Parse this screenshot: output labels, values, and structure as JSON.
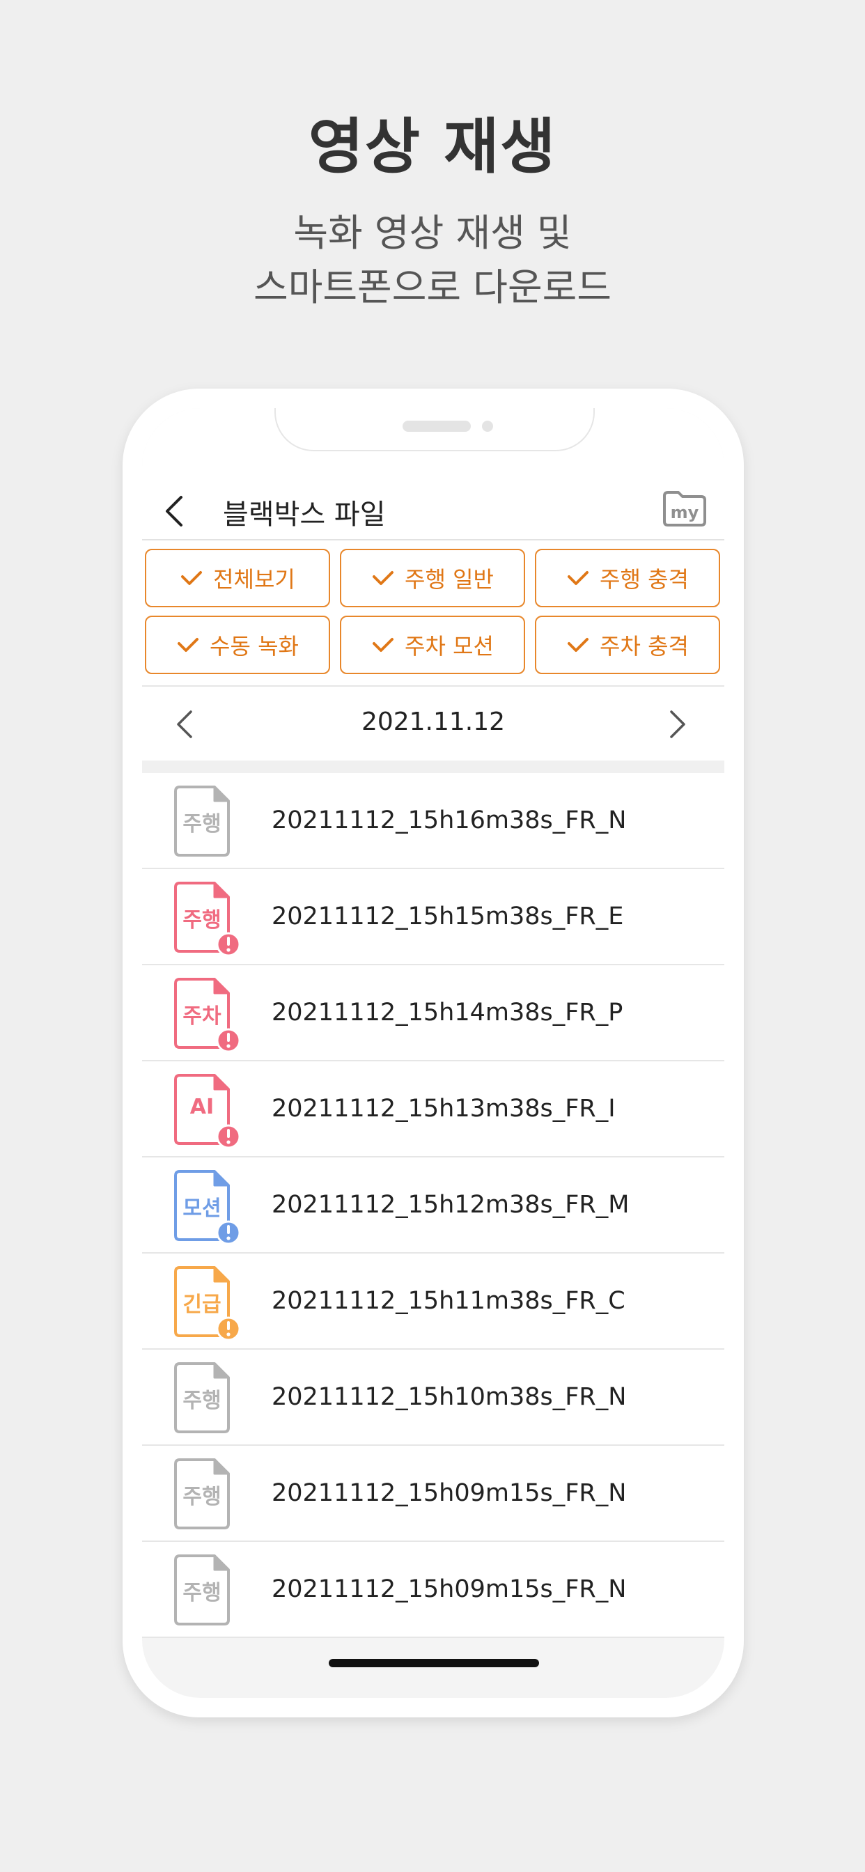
{
  "promo": {
    "headline": "영상 재생",
    "subline_1": "녹화 영상 재생 및",
    "subline_2": "스마트폰으로 다운로드"
  },
  "colors": {
    "accent": "#e8872b",
    "alert_red": "#f06b80",
    "alert_blue": "#6f9de6",
    "alert_orange": "#f7a84a",
    "neutral": "#b3b3b3"
  },
  "header": {
    "title": "블랙박스 파일",
    "back_icon": "chevron-left-icon",
    "my_folder_icon": "folder-icon",
    "my_label": "my"
  },
  "filters": [
    {
      "label": "전체보기",
      "checked": true
    },
    {
      "label": "주행 일반",
      "checked": true
    },
    {
      "label": "주행 충격",
      "checked": true
    },
    {
      "label": "수동 녹화",
      "checked": true
    },
    {
      "label": "주차 모션",
      "checked": true
    },
    {
      "label": "주차 충격",
      "checked": true
    }
  ],
  "date_nav": {
    "date": "2021.11.12",
    "prev_icon": "chevron-left-icon",
    "next_icon": "chevron-right-icon"
  },
  "files": [
    {
      "name": "20211112_15h16m38s_FR_N",
      "icon_label": "주행",
      "color": "#b3b3b3",
      "alert": false
    },
    {
      "name": "20211112_15h15m38s_FR_E",
      "icon_label": "주행",
      "color": "#f06b80",
      "alert": true
    },
    {
      "name": "20211112_15h14m38s_FR_P",
      "icon_label": "주차",
      "color": "#f06b80",
      "alert": true
    },
    {
      "name": "20211112_15h13m38s_FR_I",
      "icon_label": "AI",
      "color": "#f06b80",
      "alert": true
    },
    {
      "name": "20211112_15h12m38s_FR_M",
      "icon_label": "모션",
      "color": "#6f9de6",
      "alert": true
    },
    {
      "name": "20211112_15h11m38s_FR_C",
      "icon_label": "긴급",
      "color": "#f7a84a",
      "alert": true
    },
    {
      "name": "20211112_15h10m38s_FR_N",
      "icon_label": "주행",
      "color": "#b3b3b3",
      "alert": false
    },
    {
      "name": "20211112_15h09m15s_FR_N",
      "icon_label": "주행",
      "color": "#b3b3b3",
      "alert": false
    },
    {
      "name": "20211112_15h09m15s_FR_N",
      "icon_label": "주행",
      "color": "#b3b3b3",
      "alert": false
    }
  ]
}
